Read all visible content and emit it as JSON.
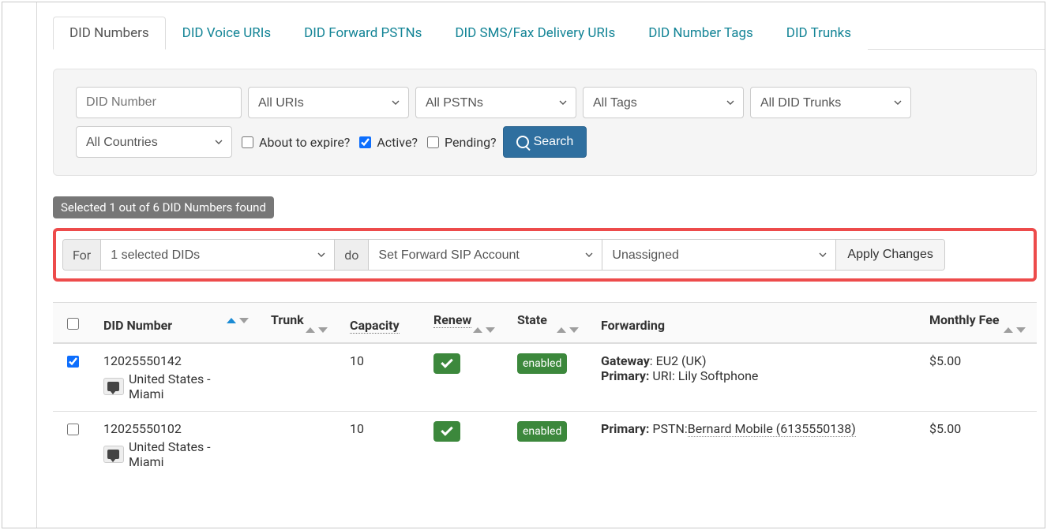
{
  "tabs": [
    {
      "label": "DID Numbers",
      "active": true
    },
    {
      "label": "DID Voice URIs",
      "active": false
    },
    {
      "label": "DID Forward PSTNs",
      "active": false
    },
    {
      "label": "DID SMS/Fax Delivery URIs",
      "active": false
    },
    {
      "label": "DID Number Tags",
      "active": false
    },
    {
      "label": "DID Trunks",
      "active": false
    }
  ],
  "filters": {
    "did_number_placeholder": "DID Number",
    "uris_selected": "All URIs",
    "pstns_selected": "All PSTNs",
    "tags_selected": "All Tags",
    "trunks_selected": "All DID Trunks",
    "countries_selected": "All Countries",
    "about_to_expire_label": "About to expire?",
    "about_to_expire": false,
    "active_label": "Active?",
    "active": true,
    "pending_label": "Pending?",
    "pending": false,
    "search_button": "Search"
  },
  "selection_status": "Selected 1 out of 6 DID Numbers found",
  "action_bar": {
    "for_label": "For",
    "selected_dids": "1 selected DIDs",
    "do_label": "do",
    "action_selected": "Set Forward SIP Account",
    "target_selected": "Unassigned",
    "apply_label": "Apply Changes"
  },
  "columns": {
    "did_number": "DID Number",
    "trunk": "Trunk",
    "capacity": "Capacity",
    "renew": "Renew",
    "state": "State",
    "forwarding": "Forwarding",
    "monthly_fee": "Monthly Fee"
  },
  "rows": [
    {
      "checked": true,
      "number": "12025550142",
      "location": "United States - Miami",
      "trunk": "",
      "capacity": "10",
      "renew": true,
      "state": "enabled",
      "forwarding_lines": [
        {
          "label": "Gateway",
          "bold": false,
          "value": ": EU2 (UK)"
        },
        {
          "label": "Primary:",
          "bold": true,
          "value": " URI: Lily Softphone"
        }
      ],
      "monthly_fee": "$5.00"
    },
    {
      "checked": false,
      "number": "12025550102",
      "location": "United States - Miami",
      "trunk": "",
      "capacity": "10",
      "renew": true,
      "state": "enabled",
      "forwarding_lines": [
        {
          "label": "Primary:",
          "bold": true,
          "value": " PSTN:",
          "extra": "Bernard Mobile (6135550138)"
        }
      ],
      "monthly_fee": "$5.00"
    }
  ]
}
